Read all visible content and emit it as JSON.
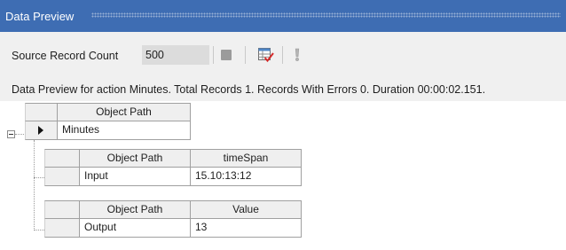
{
  "panel": {
    "title": "Data Preview"
  },
  "toolbar": {
    "source_record_count_label": "Source Record Count",
    "source_record_count_value": "500",
    "icons": [
      "stop-icon",
      "preview-table-icon",
      "exclamation-icon"
    ]
  },
  "status": {
    "text": "Data Preview for action Minutes. Total Records 1. Records With Errors 0. Duration 00:00:02.151."
  },
  "grid": {
    "header": "Object Path",
    "row": "Minutes",
    "children": [
      {
        "headers": [
          "Object Path",
          "timeSpan"
        ],
        "row": [
          "Input",
          "15.10:13:12"
        ]
      },
      {
        "headers": [
          "Object Path",
          "Value"
        ],
        "row": [
          "Output",
          "13"
        ]
      }
    ]
  },
  "colors": {
    "title_bar": "#3e6db3",
    "toolbar_bg": "#f0f0f0",
    "input_bg": "#dcdcdc",
    "header_bg": "#efefef",
    "grid_line": "#a0a0a0"
  }
}
